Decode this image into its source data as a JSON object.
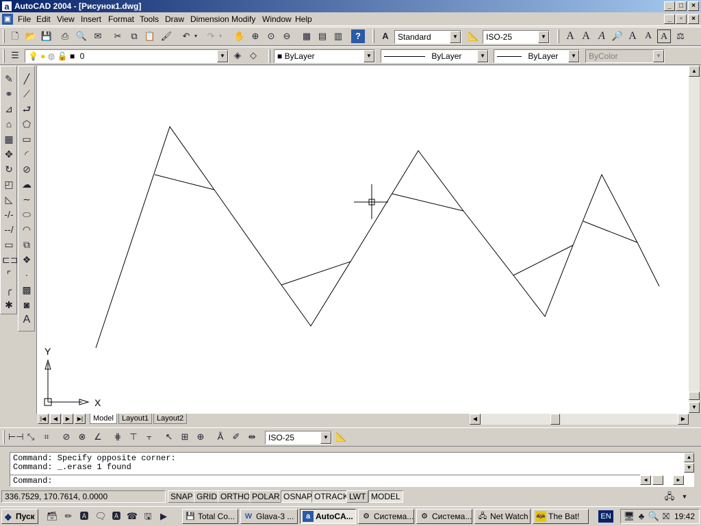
{
  "window": {
    "app_icon": "a",
    "title": "AutoCAD 2004 - [Рисунок1.dwg]",
    "buttons": [
      "_",
      "□",
      "×"
    ],
    "doc_buttons": [
      "_",
      "▫",
      "×"
    ]
  },
  "menu": [
    "File",
    "Edit",
    "View",
    "Insert",
    "Format",
    "Tools",
    "Draw",
    "Dimension",
    "Modify",
    "Window",
    "Help"
  ],
  "standard_toolbar": {
    "text_style": "Standard",
    "dim_style": "ISO-25",
    "text_icons": [
      "A",
      "A",
      "A",
      "A",
      "A",
      "A"
    ]
  },
  "layers_toolbar": {
    "layer_value": "0",
    "color_value": "ByLayer",
    "linetype_value": "ByLayer",
    "lineweight_value": "ByLayer",
    "plotstyle_value": "ByColor"
  },
  "left_toolbar_text_icon": "A",
  "ucs": {
    "y_label": "Y",
    "x_label": "X"
  },
  "tabs": [
    "Model",
    "Layout1",
    "Layout2"
  ],
  "dim_toolbar": {
    "dim_style": "ISO-25"
  },
  "command": {
    "lines": [
      "Command: Specify opposite corner:",
      "Command: _.erase 1 found"
    ],
    "prompt": "Command:"
  },
  "status": {
    "coords": "336.7529, 170.7614, 0.0000",
    "buttons": [
      "SNAP",
      "GRID",
      "ORTHO",
      "POLAR",
      "OSNAP",
      "OTRACK",
      "LWT",
      "MODEL"
    ]
  },
  "taskbar": {
    "start": "Пуск",
    "tasks": [
      "Total Co...",
      "Glava-3 ...",
      "AutoCA...",
      "Система...",
      "Система...",
      "Net Watch",
      "The Bat!"
    ],
    "lang": "EN",
    "clock": "19:42"
  },
  "colors": {
    "title_start": "#0a246a",
    "title_end": "#a6caf0",
    "canvas": "#ffffff",
    "chrome": "#d4d0c8"
  }
}
